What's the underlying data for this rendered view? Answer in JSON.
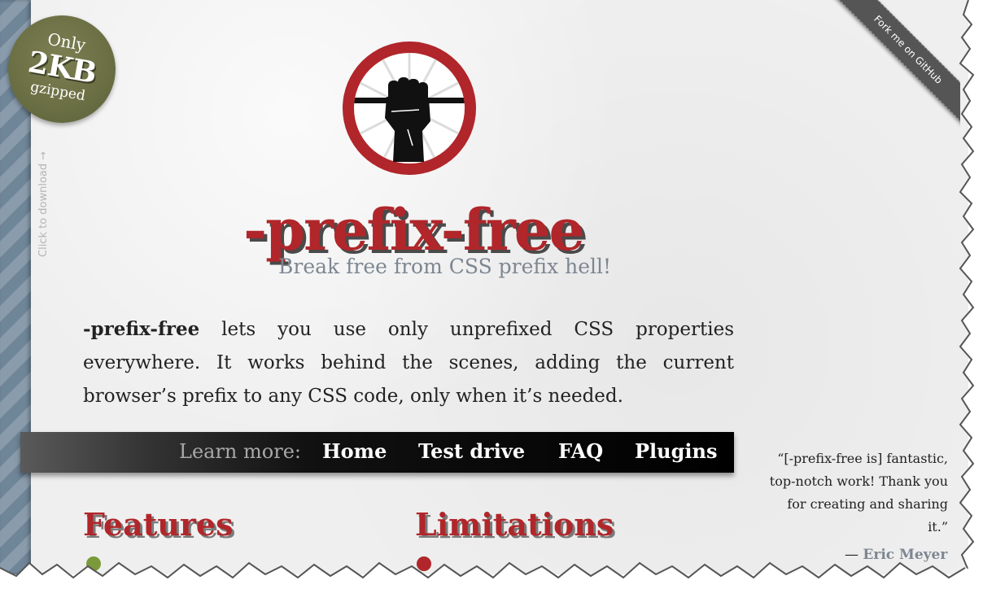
{
  "badge": {
    "line1": "Only",
    "line2": "2KB",
    "line3": "gzipped"
  },
  "sidebar": {
    "download_text": "Click to download →"
  },
  "ribbon": {
    "label": "Fork me on GitHub"
  },
  "header": {
    "title": "-prefix-free",
    "subtitle": "Break free from CSS prefix hell!"
  },
  "intro": {
    "strong": "-prefix-free",
    "rest": " lets you use only unprefixed CSS properties everywhere. It works behind the scenes, adding the current browser’s prefix to any CSS code, only when it’s needed."
  },
  "nav": {
    "label": "Learn more:",
    "items": [
      "Home",
      "Test drive",
      "FAQ",
      "Plugins"
    ]
  },
  "sections": {
    "features": "Features",
    "limitations": "Limitations"
  },
  "quote": {
    "text": "“[-prefix-free is] fantastic, top-notch work! Thank you for creating and sharing it.”",
    "dash": "— ",
    "author": "Eric Meyer"
  },
  "colors": {
    "accent": "#b0262a",
    "badge": "#6a6e43",
    "subtitle": "#7d8792",
    "nav_bg": "#000000"
  },
  "icons": {
    "logo": "raised-fist-icon"
  }
}
